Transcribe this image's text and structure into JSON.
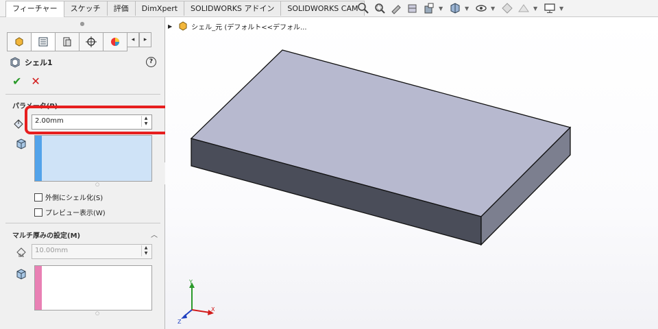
{
  "command_manager": {
    "tabs": [
      "フィーチャー",
      "スケッチ",
      "評価",
      "DimXpert",
      "SOLIDWORKS アドイン",
      "SOLIDWORKS CAM"
    ],
    "active_tab_index": 0
  },
  "property_manager": {
    "feature_title": "シェル1",
    "help_icon": "?",
    "ok_icon": "✔",
    "cancel_icon": "✕",
    "parameters": {
      "title": "パラメータ(P)",
      "thickness_value": "2.00mm",
      "faces_list_color": "#cfe3f7",
      "shell_outward_label": "外側にシェル化(S)",
      "shell_outward_checked": false,
      "show_preview_label": "プレビュー表示(W)",
      "show_preview_checked": false
    },
    "multi_thickness": {
      "title": "マルチ厚みの設定(M)",
      "thickness_value": "10.00mm",
      "faces_list_color": "#ffffff",
      "bar_color": "#e980b4"
    }
  },
  "graphics": {
    "tree_label": "シェル_元 (デフォルト<<デフォル...",
    "triad": {
      "x": "X",
      "y": "Y",
      "z": "Z"
    },
    "colors": {
      "top_face": "#b7b9cf",
      "front_face": "#4a4d59",
      "right_face": "#7c7f8f",
      "edge": "#111111",
      "highlight": "#e61e1e"
    }
  }
}
